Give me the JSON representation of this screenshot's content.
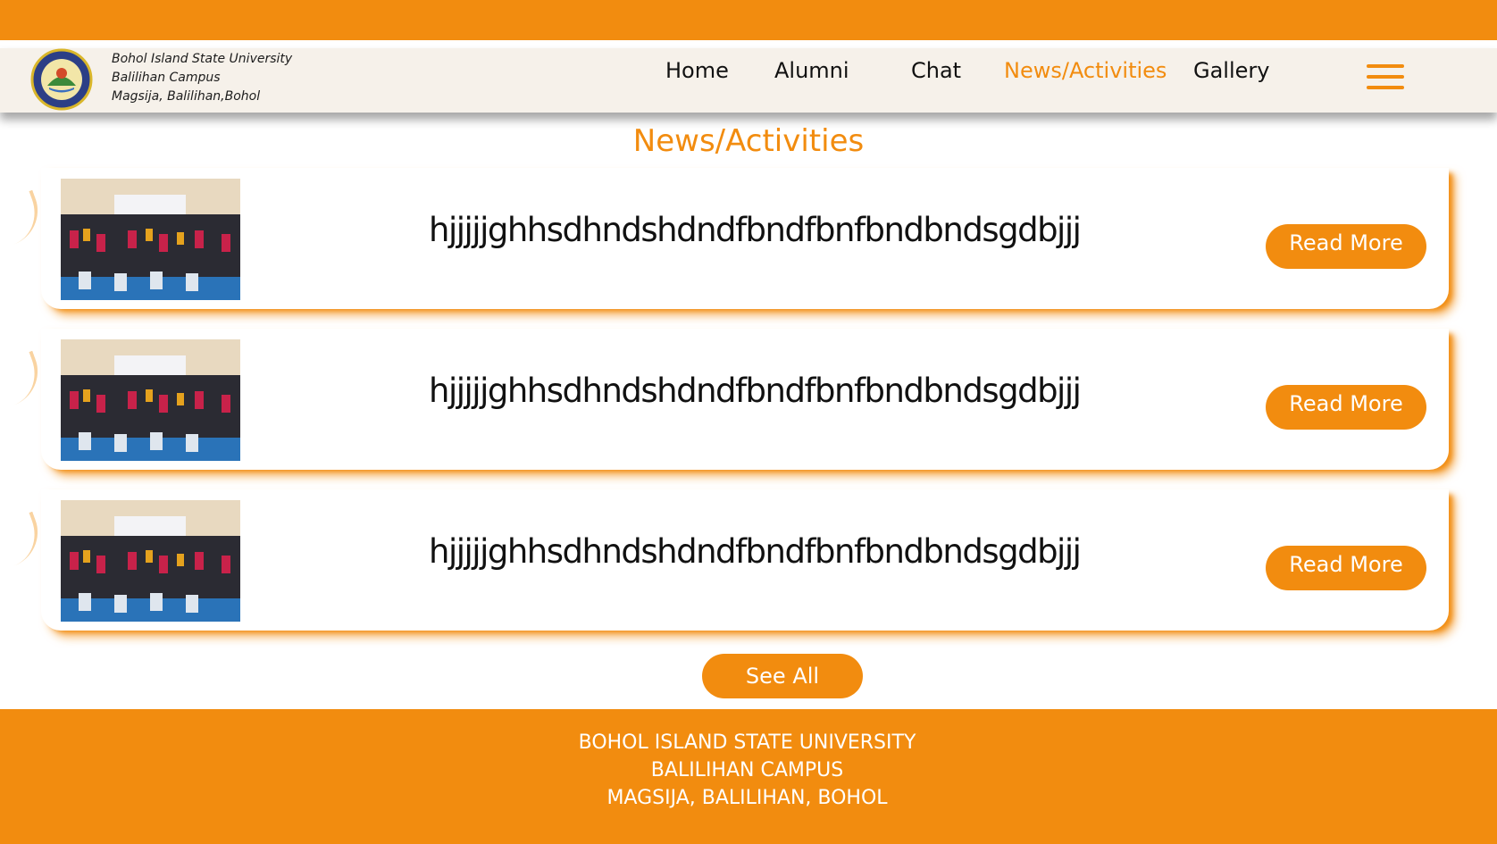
{
  "header": {
    "brand_lines": [
      "Bohol Island State University",
      "Balilihan Campus",
      "Magsija, Balilihan,Bohol"
    ],
    "nav": [
      {
        "label": "Home",
        "active": false
      },
      {
        "label": "Alumni",
        "active": false
      },
      {
        "label": "Chat",
        "active": false
      },
      {
        "label": "News/Activities",
        "active": true
      },
      {
        "label": "Gallery",
        "active": false
      }
    ],
    "menu_icon": "hamburger-menu-icon"
  },
  "main": {
    "title": "News/Activities",
    "items": [
      {
        "text": "hjjjjjghhsdhndshdndfbndfbnfbndbndsgdbjjj",
        "button": "Read More"
      },
      {
        "text": "hjjjjjghhsdhndshdndfbndfbnfbndbndsgdbjjj",
        "button": "Read More"
      },
      {
        "text": "hjjjjjghhsdhndshdndfbndfbnfbndbndsgdbjjj",
        "button": "Read More"
      }
    ],
    "see_all": "See All"
  },
  "footer": {
    "lines": [
      "BOHOL ISLAND STATE UNIVERSITY",
      "BALILIHAN CAMPUS",
      "MAGSIJA, BALILIHAN, BOHOL"
    ]
  },
  "colors": {
    "accent": "#f28c0f",
    "navbar_bg": "#f6f1ea",
    "text": "#111111"
  }
}
